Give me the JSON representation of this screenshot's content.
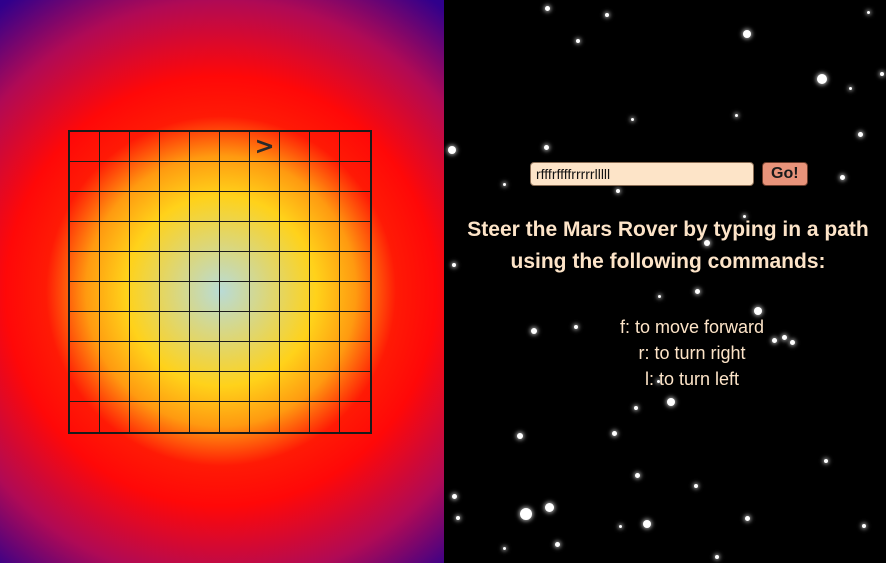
{
  "app": {
    "left_background": [
      "#b9dbd6",
      "#ffd21a",
      "#ff1a05",
      "#1c0095"
    ],
    "right_background": "#000000"
  },
  "grid": {
    "rows": 10,
    "columns": 10,
    "rover": {
      "row": 1,
      "column": 7,
      "symbol": ">",
      "facing": "east"
    }
  },
  "controls": {
    "path_input_value": "rfffrffffrrrrrlllll",
    "go_label": "Go!"
  },
  "instructions": {
    "heading_line1": "Steer the Mars Rover by typing in a path",
    "heading_line2": "using the following commands:",
    "commands": [
      "f: to move forward",
      "r: to turn right",
      "l: to turn left"
    ]
  },
  "colors": {
    "text": "#fde4c8",
    "input_bg": "#fde4c8",
    "button_bg": "#e8937a"
  },
  "stars": {
    "icon": "star-icon"
  }
}
